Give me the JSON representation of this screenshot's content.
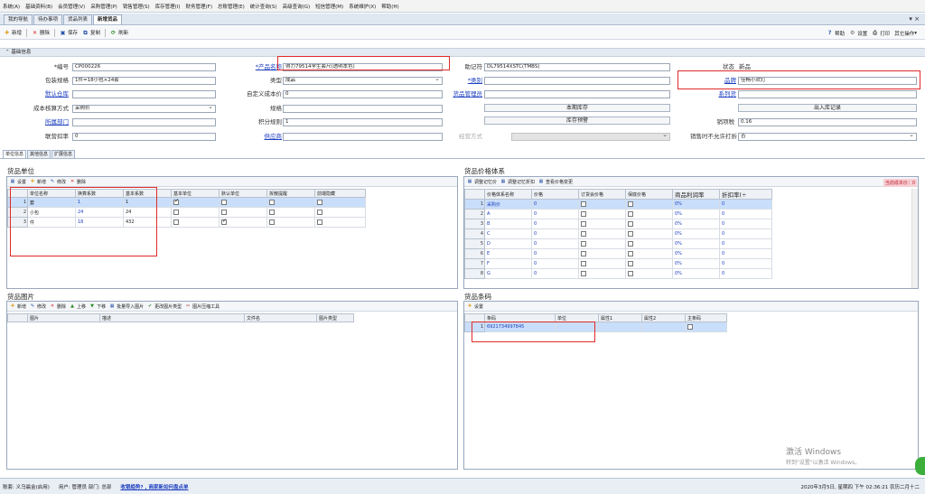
{
  "menu": [
    "系统(A)",
    "基础资料(B)",
    "会员管理(V)",
    "采购管理(P)",
    "销售管理(S)",
    "库存管理(I)",
    "财务管理(F)",
    "总账管理(E)",
    "统计查询(S)",
    "高级查询(G)",
    "短信管理(M)",
    "系统维护(X)",
    "帮助(H)"
  ],
  "tabs": [
    "我的导航",
    "待办事项",
    "货品列表",
    "新增货品"
  ],
  "toolbar": {
    "add": "新增",
    "delete": "删除",
    "save": "保存",
    "copy": "复制",
    "refresh": "刷新",
    "help": "帮助",
    "settings": "设置",
    "print": "打印",
    "other": "其它操作"
  },
  "section_title": "基础信息",
  "form": {
    "code_label": "*编号",
    "code_value": "CP000226",
    "name_label": "*产品名称",
    "name_value": "得力79514学生套尺(透明本色)",
    "mnemonic_label": "助记符",
    "mnemonic_value": "DL79514XSTC(TMBS)",
    "status_label": "状态",
    "status_value": "新品",
    "pack_label": "包装规格",
    "pack_value": "1件=18小包×24套",
    "type_label": "类型",
    "type_value": "成品",
    "category_label": "*类别",
    "category_value": "",
    "brand_label": "品牌",
    "brand_value": "佳畅小欢灯",
    "warehouse_label": "默认仓库",
    "warehouse_value": "",
    "custom_cost_label": "自定义成本价",
    "custom_cost_value": "0",
    "manager_label": "货品管理员",
    "manager_value": "",
    "series_label": "系列货",
    "series_value": "",
    "cost_method_label": "成本核算方式",
    "cost_method_value": "采购价",
    "spec_label": "规格",
    "spec_value": "",
    "month_stock_btn": "本期库存",
    "inout_btn": "出入库记录",
    "dept_label": "所属部门",
    "dept_value": "",
    "points_label": "积分规则",
    "points_value": "1",
    "stock_alert_btn": "库存预警",
    "tax_label": "销项税",
    "tax_value": "0.16",
    "discount_label": "联营扣率",
    "discount_value": "0",
    "supplier_label": "供应商",
    "supplier_value": "",
    "biz_mode_label": "经营方式",
    "biz_mode_value": "",
    "no_discount_label": "销售时不允许打折",
    "no_discount_value": "否"
  },
  "subtabs": [
    "单位信息",
    "其他信息",
    "扩展信息"
  ],
  "units": {
    "title": "货品单位",
    "tools": [
      "设置",
      "新增",
      "修改",
      "删除"
    ],
    "columns": [
      "单位名称",
      "换算系数",
      "基本系数",
      "基本单位",
      "默认单位",
      "拆散提醒",
      "前端隐藏"
    ],
    "rows": [
      {
        "n": "1",
        "name": "套",
        "factor": "1",
        "base": "1",
        "is_base": true,
        "is_default": false,
        "split": false,
        "hide": false
      },
      {
        "n": "2",
        "name": "小包",
        "factor": "24",
        "base": "24",
        "is_base": false,
        "is_default": false,
        "split": false,
        "hide": false
      },
      {
        "n": "3",
        "name": "件",
        "factor": "18",
        "base": "432",
        "is_base": false,
        "is_default": true,
        "split": false,
        "hide": false
      }
    ]
  },
  "prices": {
    "title": "货品价格体系",
    "tools": [
      "调整记忆价",
      "调整记忆折扣",
      "查看价格变更"
    ],
    "cost_badge": "当前成本价：0",
    "columns": [
      "价格体系名称",
      "价格",
      "订货会价格",
      "保底价格",
      "商品利润率",
      "折扣率(÷"
    ],
    "rows": [
      {
        "n": "1",
        "name": "采购价",
        "price": "0",
        "margin": "0%",
        "disc": "0"
      },
      {
        "n": "2",
        "name": "A",
        "price": "0",
        "margin": "0%",
        "disc": "0"
      },
      {
        "n": "3",
        "name": "B",
        "price": "0",
        "margin": "0%",
        "disc": "0"
      },
      {
        "n": "4",
        "name": "C",
        "price": "0",
        "margin": "0%",
        "disc": "0"
      },
      {
        "n": "5",
        "name": "D",
        "price": "0",
        "margin": "0%",
        "disc": "0"
      },
      {
        "n": "6",
        "name": "E",
        "price": "0",
        "margin": "0%",
        "disc": "0"
      },
      {
        "n": "7",
        "name": "F",
        "price": "0",
        "margin": "0%",
        "disc": "0"
      },
      {
        "n": "8",
        "name": "G",
        "price": "0",
        "margin": "0%",
        "disc": "0"
      }
    ]
  },
  "images": {
    "title": "货品图片",
    "tools": [
      "新增",
      "修改",
      "删除",
      "上移",
      "下移",
      "批量导入图片",
      "更改图片类型",
      "图片压缩工具"
    ],
    "columns": [
      "图片",
      "描述",
      "文件名",
      "图片类型"
    ]
  },
  "barcodes": {
    "title": "货品条码",
    "tools": [
      "设置"
    ],
    "columns": [
      "条码",
      "单位",
      "属性1",
      "属性2",
      "主条码"
    ],
    "rows": [
      {
        "n": "1",
        "code": "6921734997845",
        "unit": "",
        "a1": "",
        "a2": "",
        "main": false
      }
    ]
  },
  "status": {
    "company": "账套: 义乌晨金(启用)",
    "user": "用户: 管理员  部门: 总部",
    "notice": "收银趋势? , 商家新如何盘点单",
    "datetime": "2020年3月5日, 星期四 下午 02:36:21 农历二月十二"
  },
  "watermark": {
    "line1": "激活 Windows",
    "line2": "转到\"设置\"以激活 Windows。"
  }
}
